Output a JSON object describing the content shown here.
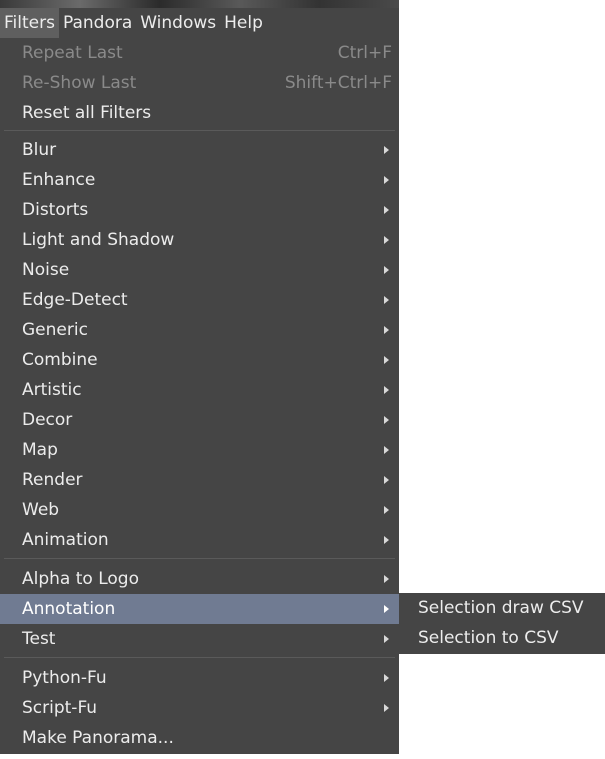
{
  "menubar": {
    "items": [
      "Filters",
      "Pandora",
      "Windows",
      "Help"
    ]
  },
  "filters_menu": {
    "repeat_last": {
      "label": "Repeat Last",
      "accel": "Ctrl+F"
    },
    "reshow_last": {
      "label": "Re-Show Last",
      "accel": "Shift+Ctrl+F"
    },
    "reset_all": {
      "label": "Reset all Filters"
    },
    "blur": "Blur",
    "enhance": "Enhance",
    "distorts": "Distorts",
    "light_shadow": "Light and Shadow",
    "noise": "Noise",
    "edge_detect": "Edge-Detect",
    "generic": "Generic",
    "combine": "Combine",
    "artistic": "Artistic",
    "decor": "Decor",
    "map": "Map",
    "render": "Render",
    "web": "Web",
    "animation": "Animation",
    "alpha_to_logo": "Alpha to Logo",
    "annotation": "Annotation",
    "test": "Test",
    "python_fu": "Python-Fu",
    "script_fu": "Script-Fu",
    "make_panorama": "Make Panorama..."
  },
  "annotation_submenu": {
    "items": [
      "Selection draw CSV",
      "Selection to CSV"
    ]
  },
  "colors": {
    "menu_bg": "#454545",
    "highlight_bg": "#707b92",
    "text": "#ececec",
    "disabled_text": "#8a8a8a"
  }
}
